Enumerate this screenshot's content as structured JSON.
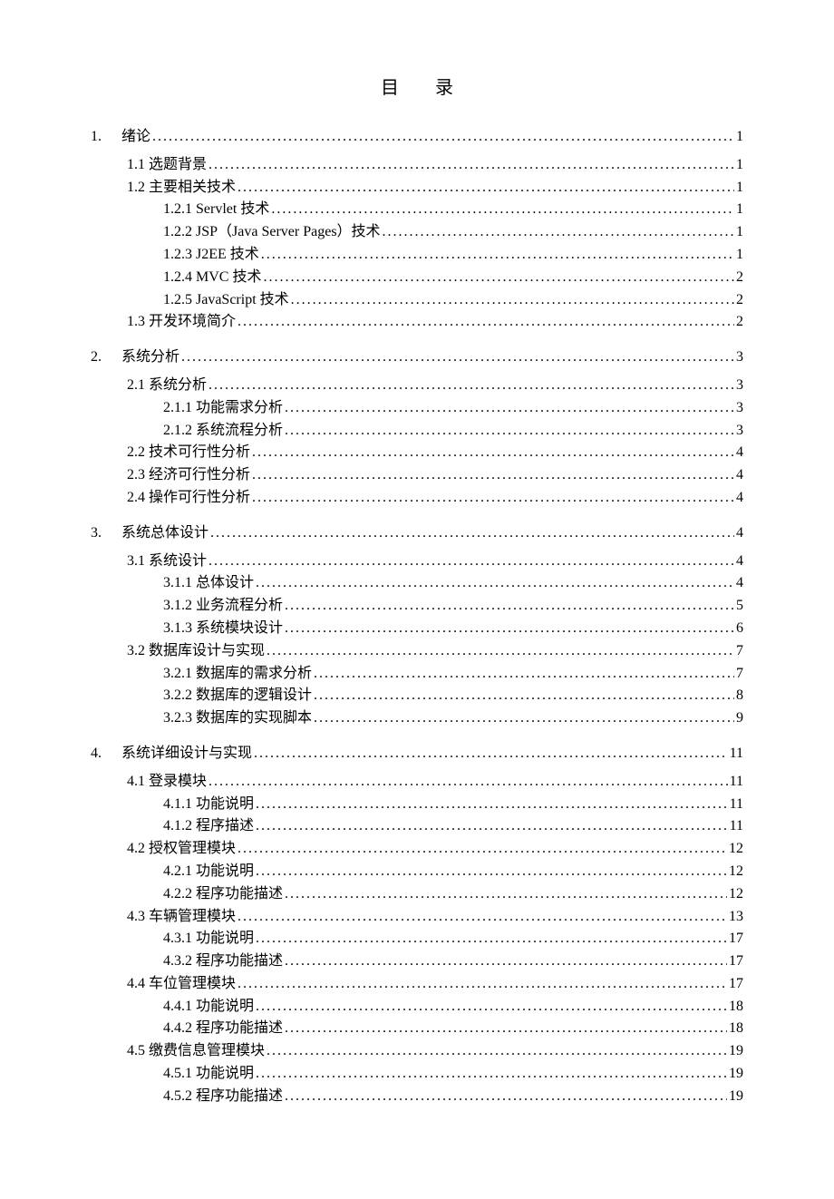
{
  "title": "目录",
  "toc": [
    {
      "num": "1.",
      "label": "绪论",
      "page": "1",
      "level": "chapter"
    },
    {
      "num": "1.1",
      "label": "选题背景",
      "page": "1",
      "level": "h1",
      "blockstart": true
    },
    {
      "num": "1.2",
      "label": "主要相关技术",
      "page": "1",
      "level": "h1"
    },
    {
      "num": "1.2.1",
      "label": "Servlet 技术",
      "page": "1",
      "level": "h2"
    },
    {
      "num": "1.2.2",
      "label": "JSP（Java Server Pages）技术",
      "page": "1",
      "level": "h2"
    },
    {
      "num": "1.2.3",
      "label": "J2EE 技术",
      "page": "1",
      "level": "h2"
    },
    {
      "num": "1.2.4",
      "label": "MVC 技术",
      "page": "2",
      "level": "h2"
    },
    {
      "num": "1.2.5",
      "label": "JavaScript 技术",
      "page": "2",
      "level": "h2"
    },
    {
      "num": "1.3",
      "label": "开发环境简介",
      "page": "2",
      "level": "h1"
    },
    {
      "num": "2.",
      "label": "系统分析",
      "page": "3",
      "level": "chapter"
    },
    {
      "num": "2.1",
      "label": "系统分析",
      "page": "3",
      "level": "h1",
      "blockstart": true
    },
    {
      "num": "2.1.1",
      "label": "功能需求分析",
      "page": "3",
      "level": "h2"
    },
    {
      "num": "2.1.2",
      "label": "系统流程分析",
      "page": "3",
      "level": "h2"
    },
    {
      "num": "2.2",
      "label": "技术可行性分析",
      "page": "4",
      "level": "h1"
    },
    {
      "num": "2.3",
      "label": "经济可行性分析",
      "page": "4",
      "level": "h1"
    },
    {
      "num": "2.4",
      "label": "操作可行性分析",
      "page": "4",
      "level": "h1"
    },
    {
      "num": "3.",
      "label": "系统总体设计",
      "page": "4",
      "level": "chapter"
    },
    {
      "num": "3.1",
      "label": "系统设计",
      "page": "4",
      "level": "h1",
      "blockstart": true
    },
    {
      "num": "3.1.1",
      "label": "总体设计",
      "page": "4",
      "level": "h2"
    },
    {
      "num": "3.1.2",
      "label": "业务流程分析",
      "page": "5",
      "level": "h2"
    },
    {
      "num": "3.1.3",
      "label": "系统模块设计",
      "page": "6",
      "level": "h2"
    },
    {
      "num": "3.2",
      "label": "数据库设计与实现",
      "page": "7",
      "level": "h1"
    },
    {
      "num": "3.2.1",
      "label": "数据库的需求分析",
      "page": "7",
      "level": "h2"
    },
    {
      "num": "3.2.2",
      "label": "数据库的逻辑设计",
      "page": "8",
      "level": "h2"
    },
    {
      "num": "3.2.3",
      "label": "数据库的实现脚本",
      "page": "9",
      "level": "h2"
    },
    {
      "num": "4.",
      "label": "系统详细设计与实现",
      "page": "11",
      "level": "chapter"
    },
    {
      "num": "4.1",
      "label": "登录模块",
      "page": "11",
      "level": "h1",
      "blockstart": true
    },
    {
      "num": "4.1.1",
      "label": "功能说明",
      "page": "11",
      "level": "h2"
    },
    {
      "num": "4.1.2",
      "label": "程序描述",
      "page": "11",
      "level": "h2"
    },
    {
      "num": "4.2",
      "label": "授权管理模块",
      "page": "12",
      "level": "h1"
    },
    {
      "num": "4.2.1",
      "label": "功能说明",
      "page": "12",
      "level": "h2"
    },
    {
      "num": "4.2.2",
      "label": "程序功能描述",
      "page": "12",
      "level": "h2"
    },
    {
      "num": "4.3",
      "label": "车辆管理模块",
      "page": "13",
      "level": "h1"
    },
    {
      "num": "4.3.1",
      "label": "功能说明",
      "page": "17",
      "level": "h2"
    },
    {
      "num": "4.3.2",
      "label": "程序功能描述",
      "page": "17",
      "level": "h2"
    },
    {
      "num": "4.4",
      "label": "车位管理模块",
      "page": "17",
      "level": "h1"
    },
    {
      "num": "4.4.1",
      "label": "功能说明",
      "page": "18",
      "level": "h2"
    },
    {
      "num": "4.4.2",
      "label": "程序功能描述",
      "page": "18",
      "level": "h2"
    },
    {
      "num": "4.5",
      "label": "缴费信息管理模块",
      "page": "19",
      "level": "h1"
    },
    {
      "num": "4.5.1",
      "label": "功能说明",
      "page": "19",
      "level": "h2"
    },
    {
      "num": "4.5.2",
      "label": "程序功能描述",
      "page": "19",
      "level": "h2"
    }
  ]
}
